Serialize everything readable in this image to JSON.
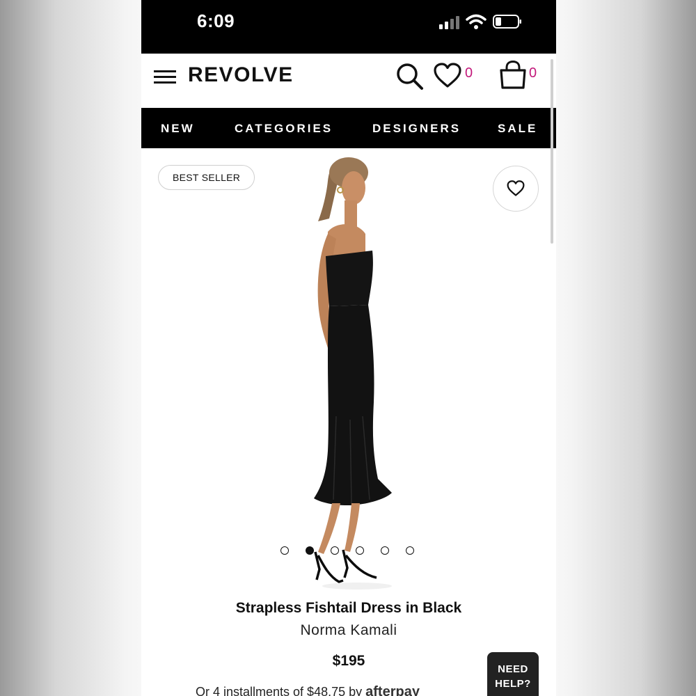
{
  "status_bar": {
    "time": "6:09"
  },
  "header": {
    "logo": "REVOLVE",
    "wishlist_count": "0",
    "bag_count": "0",
    "accent_color": "#c2187a"
  },
  "nav": {
    "items": [
      "NEW",
      "CATEGORIES",
      "DESIGNERS",
      "SALE"
    ]
  },
  "gallery": {
    "badge": "BEST SELLER",
    "image_count": 6,
    "active_image": 2
  },
  "product": {
    "title": "Strapless Fishtail Dress in Black",
    "brand": "Norma Kamali",
    "price": "$195",
    "installments_text": "Or 4 installments of $48.75 by",
    "afterpay_label": "afterpay"
  },
  "help": {
    "line1": "NEED",
    "line2": "HELP?"
  }
}
